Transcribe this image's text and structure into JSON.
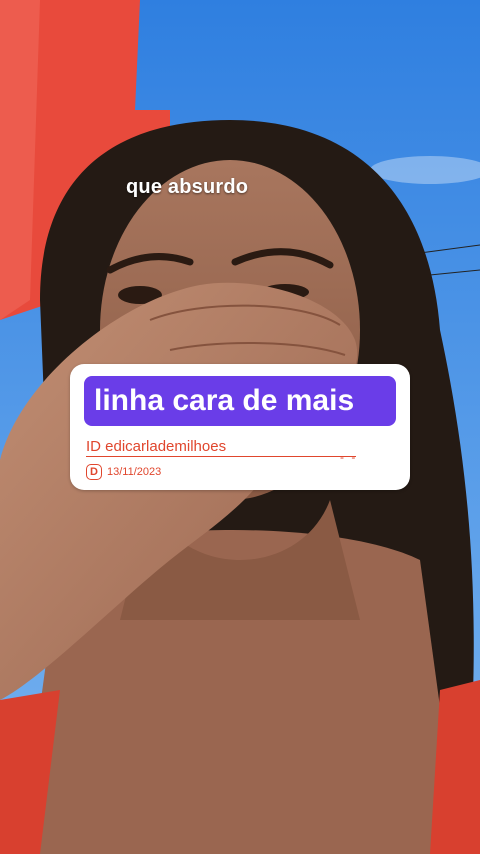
{
  "caption": "que absurdo",
  "sticker": {
    "headline": "linha cara de mais",
    "username": "ID  edicarlademilhoes",
    "dash": "- -",
    "date_icon_letter": "D",
    "date": "13/11/2023"
  },
  "colors": {
    "sky": "#3f8ee8",
    "wall": "#e84a3c",
    "headline_bg": "#6a3de8",
    "accent": "#e0462d"
  },
  "icons": [
    "d-badge-icon"
  ]
}
